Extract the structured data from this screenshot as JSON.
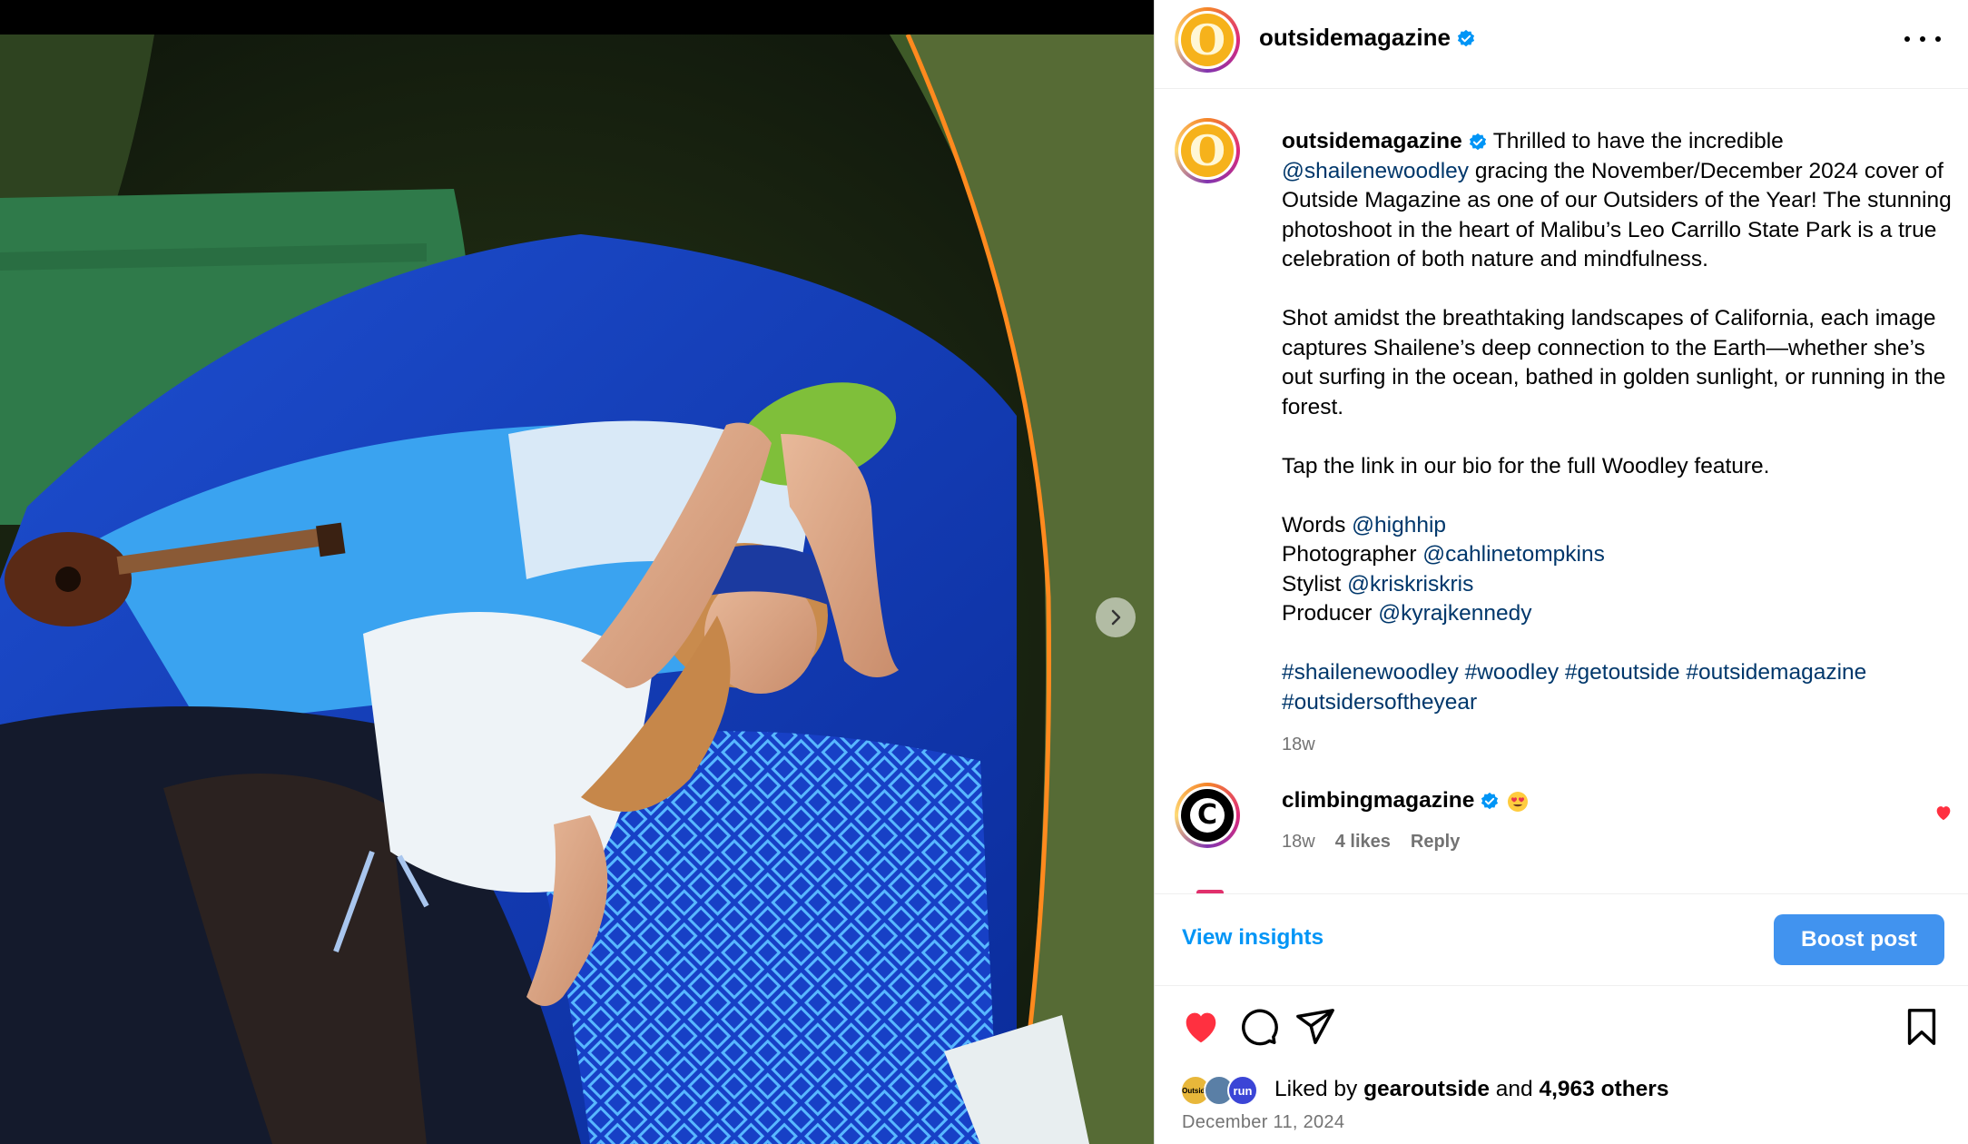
{
  "post": {
    "username": "outsidemagazine",
    "avatar_letter": "O",
    "verified": true,
    "photo_alt": "Woman lying in a tent on a blue sleeping pad beside a ukulele, wearing a white tank top and a blue cap",
    "caption": {
      "username": "outsidemagazine",
      "intro_before_mention": "Thrilled to have the incredible",
      "mention_cover": "@shailenewoodley",
      "intro_after_mention": "gracing the November/December 2024 cover of Outside Magazine as one of our Outsiders of the Year! The stunning photoshoot in the heart of Malibu’s Leo Carrillo State Park is a true celebration of both nature and mindfulness.",
      "paragraph2": "Shot amidst the breathtaking landscapes of California, each image captures Shailene’s deep connection to the Earth—whether she’s out surfing in the ocean, bathed in golden sunlight, or running in the forest.",
      "paragraph3": "Tap the link in our bio for the full Woodley feature.",
      "credits": [
        {
          "role": "Words",
          "handle": "@highhip"
        },
        {
          "role": "Photographer",
          "handle": "@cahlinetompkins"
        },
        {
          "role": "Stylist",
          "handle": "@kriskriskris"
        },
        {
          "role": "Producer",
          "handle": "@kyrajkennedy"
        }
      ],
      "hashtags": [
        "#shailenewoodley",
        "#woodley",
        "#getoutside",
        "#outsidemagazine",
        "#outsidersoftheyear"
      ],
      "timestamp": "18w"
    },
    "comment": {
      "username": "climbingmagazine",
      "avatar_letter": "C",
      "verified": true,
      "text_emoji": "heart-eyes-emoji",
      "timestamp": "18w",
      "likes": "4 likes",
      "reply": "Reply",
      "liked": true
    },
    "insights_label": "View insights",
    "boost_label": "Boost post",
    "liked_by_prefix": "Liked by",
    "liked_by_user": "gearoutside",
    "liked_by_and": "and",
    "liked_by_others": "4,963 others",
    "liker_avatars": [
      "Outside",
      "",
      "run"
    ],
    "date": "December 11, 2024",
    "liked": true
  },
  "colors": {
    "link": "#00376b",
    "action_blue": "#0095f6",
    "boost_bg": "#4193ef",
    "verified_blue": "#0095f6",
    "like_red": "#ff3040",
    "meta_gray": "#737373"
  },
  "icons": [
    "verified-badge-icon",
    "more-options-icon",
    "heart-icon",
    "comment-icon",
    "share-icon",
    "bookmark-icon",
    "carousel-next-icon"
  ]
}
